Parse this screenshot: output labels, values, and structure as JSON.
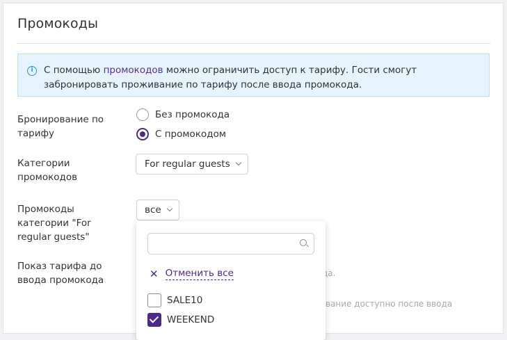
{
  "section": {
    "title": "Промокоды"
  },
  "info": {
    "icon": "info-icon",
    "text_before": "С помощью ",
    "link_text": "промокодов",
    "text_after": " можно ограничить доступ к тарифу. Гости смогут забронировать проживание по тарифу после ввода промокода."
  },
  "booking": {
    "label": "Бронирование по тарифу",
    "options": [
      {
        "label": "Без промокода",
        "selected": false
      },
      {
        "label": "С промокодом",
        "selected": true
      }
    ]
  },
  "categories": {
    "label": "Категории промокодов",
    "selected": "For regular guests"
  },
  "category_codes": {
    "label": "Промокоды категории \"For regular guests\"",
    "selected": "все"
  },
  "show_rate": {
    "label": "Показ тарифа до ввода промокода",
    "hint_partial_1": "да.",
    "hint_partial_2": "вание доступно после ввода"
  },
  "dropdown": {
    "search_placeholder": "",
    "clear_all_label": "Отменить все",
    "items": [
      {
        "label": "SALE10",
        "checked": false
      },
      {
        "label": "WEEKEND",
        "checked": true
      }
    ]
  },
  "colors": {
    "accent": "#4b2a8a",
    "info_bg": "#e4f3fc",
    "info_border": "#b9e0f5",
    "info_icon": "#2196d8"
  }
}
